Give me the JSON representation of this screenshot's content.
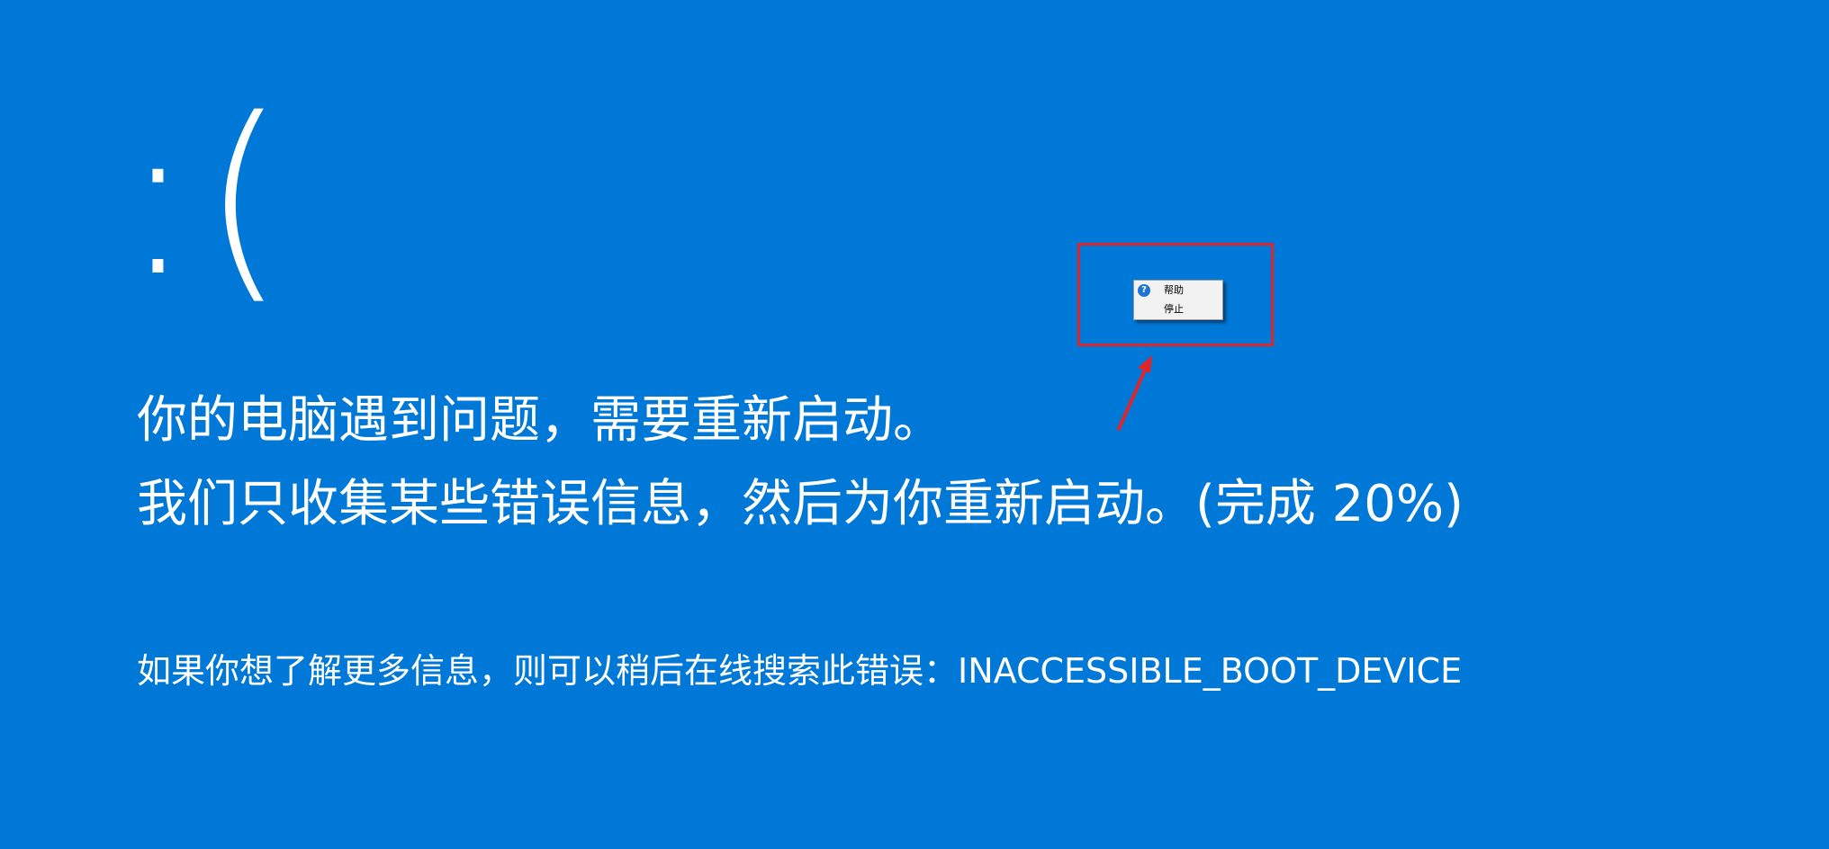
{
  "screen": {
    "background_color": "#0078d7",
    "text_color": "#ffffff",
    "sad_face": ":(",
    "line1": "你的电脑遇到问题，需要重新启动。",
    "line2": "我们只收集某些错误信息，然后为你重新启动。(完成 20%)",
    "progress_percent": 20,
    "info_line": "如果你想了解更多信息，则可以稍后在线搜索此错误：INACCESSIBLE_BOOT_DEVICE",
    "stop_code": "INACCESSIBLE_BOOT_DEVICE"
  },
  "context_menu": {
    "items": [
      {
        "label": "帮助",
        "icon": "help-question-icon"
      },
      {
        "label": "停止",
        "icon": null
      }
    ]
  },
  "annotation": {
    "color": "#e0252a"
  }
}
